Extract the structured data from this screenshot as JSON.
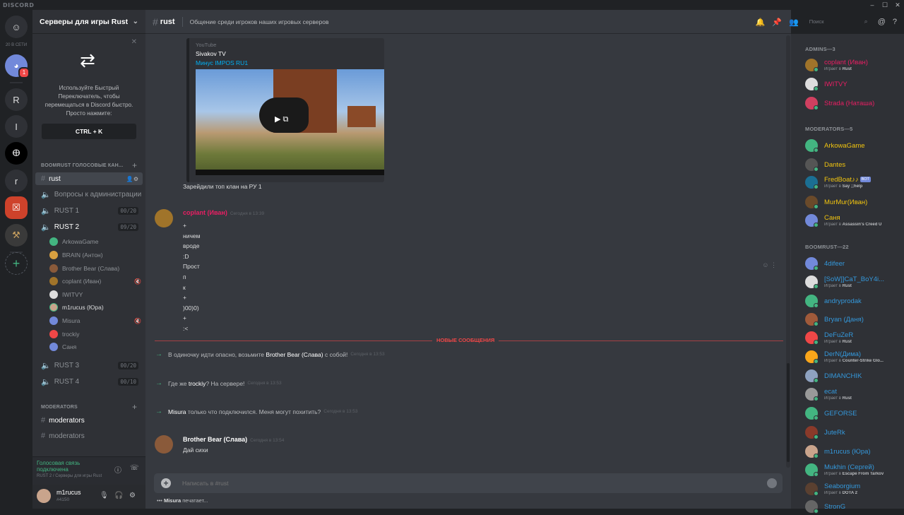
{
  "app": {
    "brand": "DISCORD"
  },
  "guilds": {
    "online_label": "20 В СЕТИ",
    "items": [
      {
        "label": "R"
      },
      {
        "label": "I"
      },
      {
        "label": "r"
      }
    ],
    "dm_badge": "1"
  },
  "server": {
    "name": "Серверы для игры Rust"
  },
  "switcher": {
    "text": "Используйте Быстрый Переключатель, чтобы перемещаться в Discord быстро. Просто нажмите:",
    "shortcut": "CTRL + K"
  },
  "sidebar": {
    "voice_category": "BOOMRUST ГОЛОСОВЫЕ КАН...",
    "channels": [
      {
        "name": "rust"
      },
      {
        "name": "Вопросы к администрации"
      },
      {
        "name": "RUST 1",
        "limit": "00/20"
      },
      {
        "name": "RUST 2",
        "limit": "09/20"
      },
      {
        "name": "RUST 3",
        "limit": "00/20"
      },
      {
        "name": "RUST 4",
        "limit": "00/10"
      }
    ],
    "voice_users": [
      {
        "name": "ArkowaGame",
        "color": "#43b581"
      },
      {
        "name": "BRAIN (Антон)",
        "color": "#d8a040"
      },
      {
        "name": "Brother Bear (Слава)",
        "color": "#8a5a3a"
      },
      {
        "name": "coplant (Иван)",
        "color": "#a0742a"
      },
      {
        "name": "IWITVY",
        "color": "#dddddd"
      },
      {
        "name": "m1rucus (Юра)",
        "color": "#c9a48c"
      },
      {
        "name": "Misura",
        "color": "#7289da"
      },
      {
        "name": "trockiy",
        "color": "#f04747"
      },
      {
        "name": "Саня",
        "color": "#7289da"
      }
    ],
    "mod_category": "MODERATORS",
    "mod_channels": [
      {
        "name": "moderators"
      },
      {
        "name": "moderators"
      }
    ]
  },
  "voice_panel": {
    "status": "Голосовая связь подключена",
    "sub": "RUST 2 / Серверы для игры Rust"
  },
  "user": {
    "name": "m1rucus",
    "tag": "#4150"
  },
  "chat": {
    "channel": "rust",
    "topic": "Общение среди игроков наших игровых серверов",
    "search_placeholder": "Поиск",
    "embed": {
      "provider": "YouTube",
      "author": "Sivakov TV",
      "title": "Минус IMPOS RU1"
    },
    "embed_caption": "Зарейдили топ клан на РУ 1",
    "msg1": {
      "author": "coplant (Иван)",
      "author_color": "#e91e63",
      "time": "Сегодня в 13:39",
      "lines": [
        "+",
        "ничем",
        "вроде",
        ":D",
        "Прост",
        "п",
        "к",
        "+",
        ")00)0)",
        "+",
        ":<"
      ]
    },
    "new_messages": "НОВЫЕ СООБЩЕНИЯ",
    "system": [
      {
        "pre": "В одиночку идти опасно, возьмите ",
        "name": "Brother Bear (Слава)",
        "post": " с собой!",
        "time": "Сегодня в 13:53"
      },
      {
        "pre": "Где же ",
        "name": "trockiy",
        "post": "? На сервере!",
        "time": "Сегодня в 13:53"
      },
      {
        "pre": "",
        "name": "Misura",
        "post": " только что подключился. Меня могут похитить?",
        "time": "Сегодня в 13:53"
      }
    ],
    "msg2": {
      "author": "Brother Bear (Слава)",
      "time": "Сегодня в 13:54",
      "text": "Дай сихи"
    },
    "input_placeholder": "Написать в #rust",
    "typing_user": "Misura",
    "typing_text": "печатает..."
  },
  "members": {
    "admins_label": "ADMINS—3",
    "mods_label": "MODERATORS—5",
    "boom_label": "BOOMRUST—22",
    "admins": [
      {
        "name": "coplant (Иван)",
        "color": "#e91e63",
        "activity_pre": "Играет в ",
        "activity": "Rust",
        "av": "#a0742a"
      },
      {
        "name": "IWITVY",
        "color": "#e91e63",
        "av": "#dddddd"
      },
      {
        "name": "Strada (Наташа)",
        "color": "#e91e63",
        "av": "#d04060"
      }
    ],
    "mods": [
      {
        "name": "ArkowaGame",
        "color": "#f1c40f",
        "av": "#43b581"
      },
      {
        "name": "Dantes",
        "color": "#f1c40f",
        "av": "#555555"
      },
      {
        "name": "FredBoat♪♪",
        "color": "#f1c40f",
        "bot": "BOT",
        "activity_pre": "Играет в ",
        "activity": "Say ;;help",
        "av": "#1b6f93"
      },
      {
        "name": "MurMur(Иван)",
        "color": "#f1c40f",
        "av": "#6a4a2a"
      },
      {
        "name": "Саня",
        "color": "#f1c40f",
        "activity_pre": "Играет в ",
        "activity": "Assassin's Creed U",
        "av": "#7289da"
      }
    ],
    "boom": [
      {
        "name": "4difeer",
        "av": "#7289da"
      },
      {
        "name": "[SoW]]CaT_BoY4i...",
        "activity_pre": "Играет в ",
        "activity": "Rust",
        "av": "#dddddd"
      },
      {
        "name": "andryprodak",
        "av": "#43b581"
      },
      {
        "name": "Bryan (Даня)",
        "av": "#a05a3a"
      },
      {
        "name": "DeFuZeR",
        "activity_pre": "Играет в ",
        "activity": "Rust",
        "av": "#f04747"
      },
      {
        "name": "DerN(Дима)",
        "activity_pre": "Играет в ",
        "activity": "Counter-Strike Glo...",
        "av": "#faa61a"
      },
      {
        "name": "DIMANCHIK",
        "av": "#8ea2c0"
      },
      {
        "name": "ecat",
        "activity_pre": "Играет в ",
        "activity": "Rust",
        "av": "#999999"
      },
      {
        "name": "GEFORSE",
        "av": "#43b581"
      },
      {
        "name": "JuteRk",
        "av": "#8a3a2a"
      },
      {
        "name": "m1rucus (Юра)",
        "av": "#c9a48c"
      },
      {
        "name": "Mukhin (Сергей)",
        "activity_pre": "Играет в ",
        "activity": "Escape From Tarkov",
        "av": "#43b581"
      },
      {
        "name": "Seaborgium",
        "activity_pre": "Играет в ",
        "activity": "DOTA 2",
        "av": "#5a4030"
      },
      {
        "name": "StronG",
        "av": "#666666"
      }
    ],
    "boom_color": "#3498db"
  }
}
